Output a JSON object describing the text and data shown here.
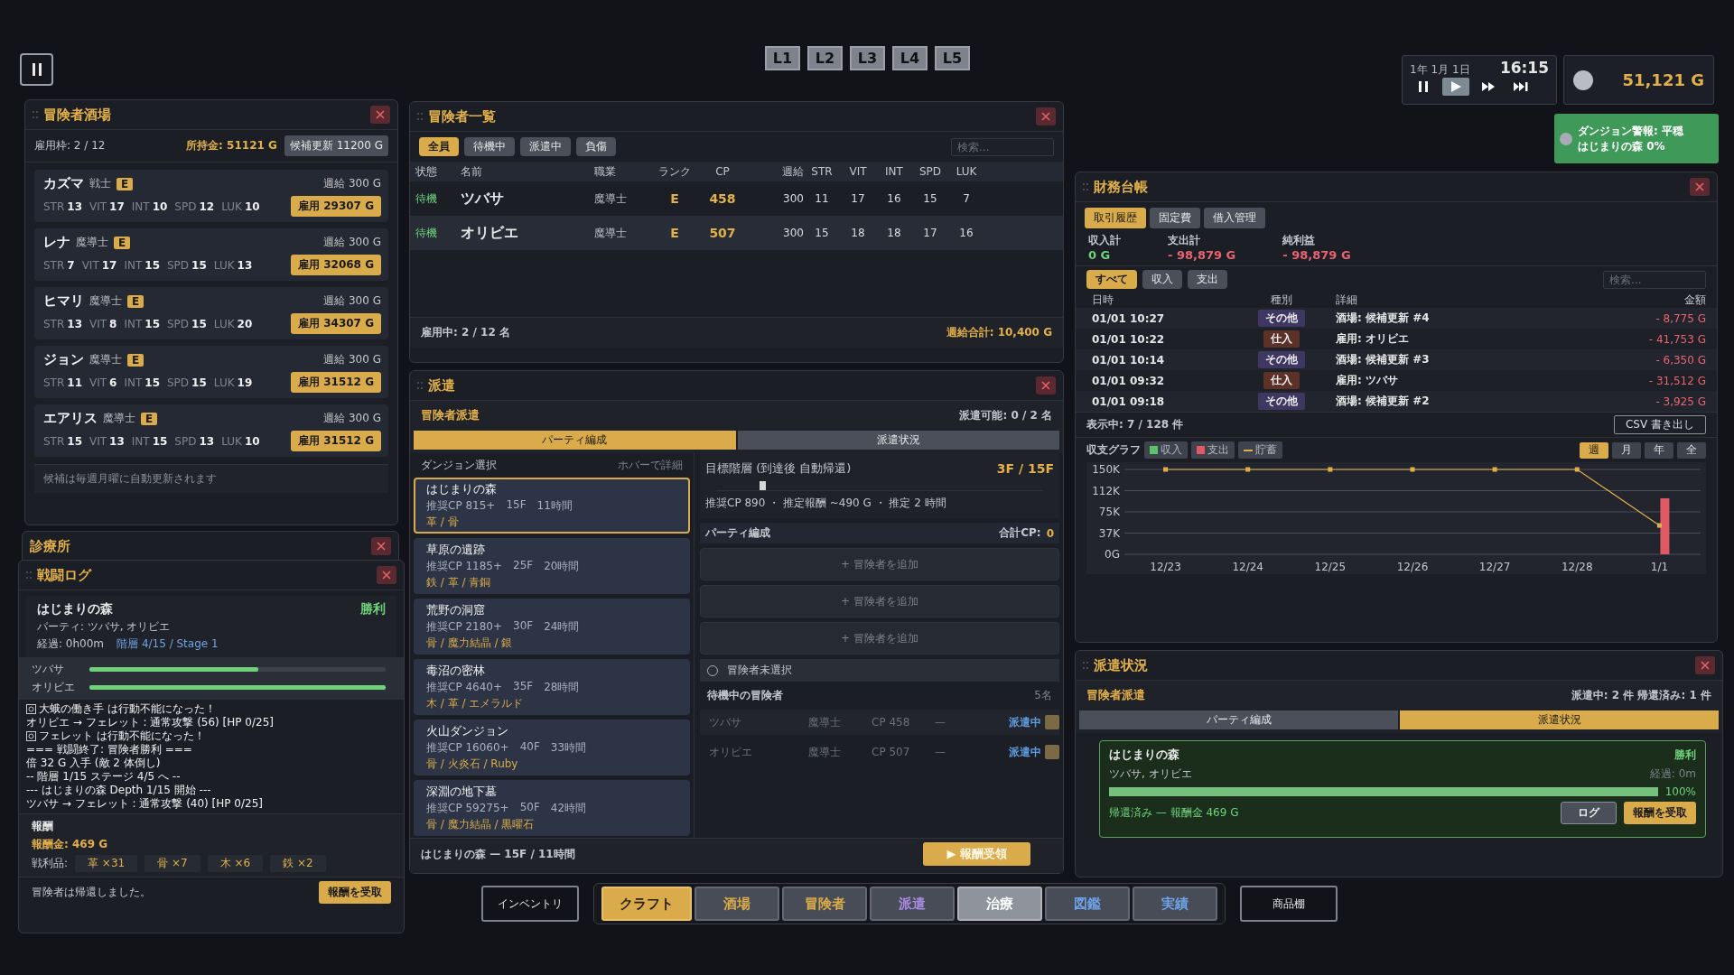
{
  "layers": [
    {
      "label": "L1",
      "selected": false
    },
    {
      "label": "L2",
      "selected": false
    },
    {
      "label": "L3",
      "selected": false
    },
    {
      "label": "L4",
      "selected": false
    },
    {
      "label": "L5",
      "selected": false
    }
  ],
  "clock": {
    "date": "1年 1月 1日",
    "time": "16:15",
    "speeds": [
      {
        "kind": "pause",
        "selected": false
      },
      {
        "kind": "play",
        "selected": true
      },
      {
        "kind": "fast",
        "selected": false
      },
      {
        "kind": "skip",
        "selected": false
      }
    ]
  },
  "funds": "51,121 G",
  "alert": {
    "title": "ダンジョン警報: 平穏",
    "detail": "はじまりの森 0%"
  },
  "tavern": {
    "title": "冒険者酒場",
    "slots": "雇用枠: 2 / 12",
    "money": "所持金: 51121 G",
    "refresh": {
      "label": "候補更新",
      "cost": "11200 G"
    },
    "candidates": [
      {
        "name": "カズマ",
        "job": "戦士",
        "rank": "E",
        "salary": "週給 300 G",
        "stats": [
          {
            "label": "STR",
            "value": "13"
          },
          {
            "label": "VIT",
            "value": "17"
          },
          {
            "label": "INT",
            "value": "10"
          },
          {
            "label": "SPD",
            "value": "12"
          },
          {
            "label": "LUK",
            "value": "10"
          }
        ],
        "hire": "雇用",
        "cost": "29307 G"
      },
      {
        "name": "レナ",
        "job": "魔導士",
        "rank": "E",
        "salary": "週給 300 G",
        "stats": [
          {
            "label": "STR",
            "value": "7"
          },
          {
            "label": "VIT",
            "value": "17"
          },
          {
            "label": "INT",
            "value": "15"
          },
          {
            "label": "SPD",
            "value": "15"
          },
          {
            "label": "LUK",
            "value": "13"
          }
        ],
        "hire": "雇用",
        "cost": "32068 G"
      },
      {
        "name": "ヒマリ",
        "job": "魔導士",
        "rank": "E",
        "salary": "週給 300 G",
        "stats": [
          {
            "label": "STR",
            "value": "13"
          },
          {
            "label": "VIT",
            "value": "8"
          },
          {
            "label": "INT",
            "value": "15"
          },
          {
            "label": "SPD",
            "value": "15"
          },
          {
            "label": "LUK",
            "value": "20"
          }
        ],
        "hire": "雇用",
        "cost": "34307 G"
      },
      {
        "name": "ジョン",
        "job": "魔導士",
        "rank": "E",
        "salary": "週給 300 G",
        "stats": [
          {
            "label": "STR",
            "value": "11"
          },
          {
            "label": "VIT",
            "value": "6"
          },
          {
            "label": "INT",
            "value": "15"
          },
          {
            "label": "SPD",
            "value": "15"
          },
          {
            "label": "LUK",
            "value": "19"
          }
        ],
        "hire": "雇用",
        "cost": "31512 G"
      },
      {
        "name": "エアリス",
        "job": "魔導士",
        "rank": "E",
        "salary": "週給 300 G",
        "stats": [
          {
            "label": "STR",
            "value": "15"
          },
          {
            "label": "VIT",
            "value": "13"
          },
          {
            "label": "INT",
            "value": "15"
          },
          {
            "label": "SPD",
            "value": "13"
          },
          {
            "label": "LUK",
            "value": "10"
          }
        ],
        "hire": "雇用",
        "cost": "31512 G"
      }
    ],
    "footer": "候補は毎週月曜に自動更新されます"
  },
  "clinic": {
    "title": "診療所"
  },
  "battle_log": {
    "title": "戦闘ログ",
    "dungeon": "はじまりの森",
    "result": "勝利",
    "party": "パーティ: ツバサ, オリビエ",
    "elapsed": "経過: 0h00m",
    "floor": "階層 4/15 / Stage 1",
    "hp": [
      {
        "name": "ツバサ",
        "level": 0.57
      },
      {
        "name": "オリビエ",
        "level": 1
      }
    ],
    "lines": [
      {
        "icon": true,
        "text": "大蛾の働き手 は行動不能になった！"
      },
      {
        "icon": false,
        "text": "オリビエ → フェレット : 通常攻撃 (56) [HP 0/25]"
      },
      {
        "icon": true,
        "text": "フェレット は行動不能になった！"
      },
      {
        "icon": false,
        "text": "=== 戦闘終了: 冒険者勝利 ==="
      },
      {
        "icon": false,
        "text": "倍 32 G 入手 (敵 2 体倒し)"
      },
      {
        "icon": false,
        "text": "-- 階層 1/15  ステージ 4/5 へ --"
      },
      {
        "icon": false,
        "text": "--- はじまりの森 Depth 1/15 開始 ---"
      },
      {
        "icon": false,
        "text": "ツバサ → フェレット : 通常攻撃 (40) [HP 0/25]"
      }
    ],
    "reward_title": "報酬",
    "reward_gold": "報酬金: 469 G",
    "loot_label": "戦利品:",
    "loot": [
      "革 ×31",
      "骨 ×7",
      "木 ×6",
      "鉄 ×2"
    ],
    "status": "冒険者は帰還しました。",
    "claim": "報酬を受取"
  },
  "adventurers": {
    "title": "冒険者一覧",
    "filters": [
      {
        "label": "全員",
        "selected": true
      },
      {
        "label": "待機中",
        "selected": false
      },
      {
        "label": "派遣中",
        "selected": false
      },
      {
        "label": "負傷",
        "selected": false
      }
    ],
    "search": {
      "placeholder": "検索..."
    },
    "columns": [
      "状態",
      "名前",
      "職業",
      "ランク",
      "CP",
      "週給",
      "STR",
      "VIT",
      "INT",
      "SPD",
      "LUK"
    ],
    "rows": [
      {
        "state": "待機",
        "name": "ツバサ",
        "job": "魔導士",
        "rank": "E",
        "cp": "458",
        "salary": "300",
        "stats": [
          "11",
          "17",
          "16",
          "15",
          "7"
        ]
      },
      {
        "state": "待機",
        "name": "オリビエ",
        "job": "魔導士",
        "rank": "E",
        "cp": "507",
        "salary": "300",
        "stats": [
          "15",
          "18",
          "18",
          "17",
          "16"
        ]
      }
    ],
    "employed": "雇用中: 2 / 12 名",
    "total": "週給合計: 10,400 G"
  },
  "dispatch": {
    "title": "派遣",
    "heading": "冒険者派遣",
    "available": "派遣可能: 0 / 2 名",
    "tabs": [
      {
        "label": "パーティ編成",
        "selected": true
      },
      {
        "label": "派遣状況",
        "selected": false
      }
    ],
    "dungeon_header": "ダンジョン選択",
    "hint": "ホバーで詳細",
    "dungeons": [
      {
        "name": "はじまりの森",
        "cp": "推奨CP 815+",
        "floors": "15F",
        "time": "11時間",
        "loot": "革 / 骨",
        "selected": true
      },
      {
        "name": "草原の遺跡",
        "cp": "推奨CP 1185+",
        "floors": "25F",
        "time": "20時間",
        "loot": "鉄 / 革 / 青銅",
        "selected": false
      },
      {
        "name": "荒野の洞窟",
        "cp": "推奨CP 2180+",
        "floors": "30F",
        "time": "24時間",
        "loot": "骨 / 魔力結晶 / 銀",
        "selected": false
      },
      {
        "name": "毒沼の密林",
        "cp": "推奨CP 4640+",
        "floors": "35F",
        "time": "28時間",
        "loot": "木 / 革 / エメラルド",
        "selected": false
      },
      {
        "name": "火山ダンジョン",
        "cp": "推奨CP 16060+",
        "floors": "40F",
        "time": "33時間",
        "loot": "骨 / 火炎石 / Ruby",
        "selected": false
      },
      {
        "name": "深淵の地下墓",
        "cp": "推奨CP 59275+",
        "floors": "50F",
        "time": "42時間",
        "loot": "骨 / 魔力結晶 / 黒曜石",
        "selected": false
      }
    ],
    "target": "目標階層 (到達後 自動帰還)",
    "target_value": "3F / 15F",
    "slider": {
      "level": 0.14
    },
    "estimate": "推奨CP 890  ・  推定報酬 ~490 G  ・  推定 2 時間",
    "party_header": "パーティ編成",
    "total_cp_label": "合計CP:",
    "total_cp": "0",
    "slots": [
      "+ 冒険者を追加",
      "+ 冒険者を追加",
      "+ 冒険者を追加"
    ],
    "selector": {
      "label": "冒険者未選択",
      "checked": false
    },
    "waiting_header": "待機中の冒険者",
    "waiting_count": "5名",
    "waiting": [
      {
        "name": "ツバサ",
        "job": "魔導士",
        "cp": "CP 458",
        "dash": "—",
        "status": "派遣中",
        "disabled": true
      },
      {
        "name": "オリビエ",
        "job": "魔導士",
        "cp": "CP 507",
        "dash": "—",
        "status": "派遣中",
        "disabled": true
      }
    ],
    "summary": "はじまりの森 — 15F / 11時間",
    "claim": "▶ 報酬受領"
  },
  "finance": {
    "title": "財務台帳",
    "tabs": [
      {
        "label": "取引履歴",
        "selected": true
      },
      {
        "label": "固定費",
        "selected": false
      },
      {
        "label": "借入管理",
        "selected": false
      }
    ],
    "totals": [
      {
        "label": "収入計",
        "value": "0 G",
        "kind": "income"
      },
      {
        "label": "支出計",
        "value": "- 98,879 G",
        "kind": "expense"
      },
      {
        "label": "純利益",
        "value": "- 98,879 G",
        "kind": "expense"
      }
    ],
    "filters": [
      {
        "label": "すべて",
        "selected": true
      },
      {
        "label": "収入",
        "selected": false
      },
      {
        "label": "支出",
        "selected": false
      }
    ],
    "search": {
      "placeholder": "検索..."
    },
    "columns": [
      "日時",
      "種別",
      "詳細",
      "金額"
    ],
    "rows": [
      {
        "date": "01/01 10:27",
        "type": "その他",
        "color": "#3d3762",
        "detail": "酒場: 候補更新 #4",
        "amount": "- 8,775 G"
      },
      {
        "date": "01/01 10:22",
        "type": "仕入",
        "color": "#5b3128",
        "detail": "雇用: オリビエ",
        "amount": "- 41,753 G"
      },
      {
        "date": "01/01 10:14",
        "type": "その他",
        "color": "#3d3762",
        "detail": "酒場: 候補更新 #3",
        "amount": "- 6,350 G"
      },
      {
        "date": "01/01 09:32",
        "type": "仕入",
        "color": "#5b3128",
        "detail": "雇用: ツバサ",
        "amount": "- 31,512 G"
      },
      {
        "date": "01/01 09:18",
        "type": "その他",
        "color": "#3d3762",
        "detail": "酒場: 候補更新 #2",
        "amount": "- 3,925 G"
      }
    ],
    "showing": "表示中: 7 / 128 件",
    "csv": "CSV 書き出し",
    "graph_label": "収支グラフ",
    "periods": [
      {
        "label": "週",
        "selected": true
      },
      {
        "label": "月",
        "selected": false
      },
      {
        "label": "年",
        "selected": false
      },
      {
        "label": "全",
        "selected": false
      }
    ],
    "chart_data": {
      "type": "bar",
      "grid": true,
      "categories": [
        "12/23",
        "12/24",
        "12/25",
        "12/26",
        "12/27",
        "12/28",
        "1/1"
      ],
      "ylim": [
        0,
        150000
      ],
      "yticks": [
        {
          "value": 0,
          "label": "0G"
        },
        {
          "value": 37500,
          "label": "37K"
        },
        {
          "value": 75000,
          "label": "75K"
        },
        {
          "value": 112500,
          "label": "112K"
        },
        {
          "value": 150000,
          "label": "150K"
        }
      ],
      "series": [
        {
          "name": "収入",
          "color": "#5cc46a",
          "type": "bar",
          "values": [
            0,
            0,
            0,
            0,
            0,
            0,
            0
          ]
        },
        {
          "name": "支出",
          "color": "#e05a64",
          "type": "bar",
          "values": [
            0,
            0,
            0,
            0,
            0,
            0,
            99000
          ]
        },
        {
          "name": "貯蓄",
          "color": "#e2b04a",
          "type": "line",
          "marker": "square",
          "values": [
            150000,
            150000,
            150000,
            150000,
            150000,
            150000,
            51000
          ]
        }
      ]
    }
  },
  "dispatch_status": {
    "title": "派遣状況",
    "heading": "冒険者派遣",
    "counts": "派遣中: 2 件  帰還済み: 1 件",
    "tabs": [
      {
        "label": "パーティ編成",
        "selected": false
      },
      {
        "label": "派遣状況",
        "selected": true
      }
    ],
    "card": {
      "dungeon": "はじまりの森",
      "result": "勝利",
      "party": "ツバサ, オリビエ",
      "elapsed": "経過: 0m",
      "level": 1,
      "percent": "100%",
      "status": "帰還済み — 報酬金 469 G",
      "log": "ログ",
      "claim": "報酬を受取"
    }
  },
  "nav": {
    "left": "インベントリ",
    "items": [
      {
        "label": "クラフト",
        "selected": true,
        "hovered": false,
        "kind": "craft"
      },
      {
        "label": "酒場",
        "selected": false,
        "hovered": false,
        "kind": "guild"
      },
      {
        "label": "冒険者",
        "selected": false,
        "hovered": false,
        "kind": "guild"
      },
      {
        "label": "派遣",
        "selected": false,
        "hovered": false,
        "kind": "expedition"
      },
      {
        "label": "治療",
        "selected": false,
        "hovered": true,
        "kind": "care"
      },
      {
        "label": "図鑑",
        "selected": false,
        "hovered": false,
        "kind": "records"
      },
      {
        "label": "実績",
        "selected": false,
        "hovered": false,
        "kind": "records"
      }
    ],
    "right": "商品棚"
  }
}
